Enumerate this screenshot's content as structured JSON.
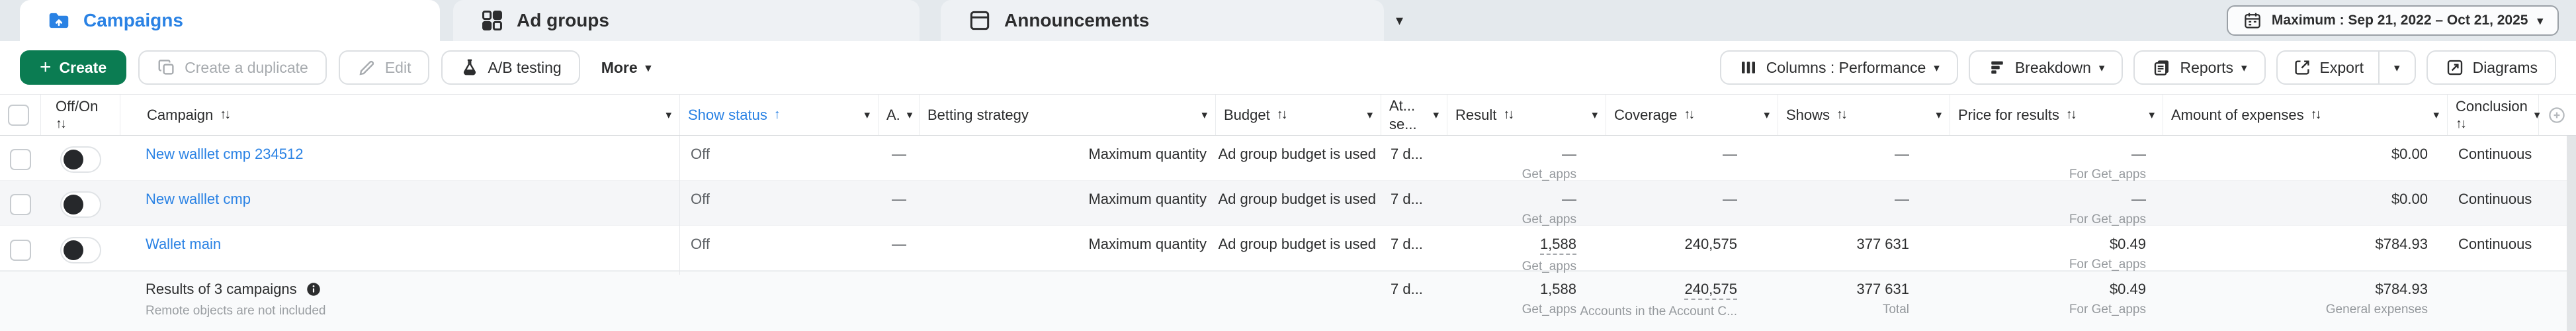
{
  "colors": {
    "accent_blue": "#2a82e4",
    "accent_green": "#0b7c52",
    "text_dark": "#2c2d2e",
    "text_gray": "#95999d"
  },
  "tabs": {
    "campaigns": "Campaigns",
    "ad_groups": "Ad groups",
    "announcements": "Announcements"
  },
  "date_range": {
    "label": "Maximum : Sep 21, 2022 – Oct 21, 2025"
  },
  "toolbar": {
    "create": "Create",
    "duplicate": "Create a duplicate",
    "edit": "Edit",
    "ab_testing": "A/B testing",
    "more": "More",
    "columns": "Columns : Performance",
    "breakdown": "Breakdown",
    "reports": "Reports",
    "export": "Export",
    "diagrams": "Diagrams"
  },
  "icons": {
    "caret_down": "▾",
    "sort_both": "↑↓",
    "sort_up": "↑",
    "plus": "+"
  },
  "table": {
    "headers": {
      "off_on": "Off/On",
      "campaign": "Campaign",
      "show_status": "Show status",
      "account": "A.",
      "betting_strategy": "Betting strategy",
      "budget": "Budget",
      "at_line1": "At...",
      "at_line2": "se...",
      "result": "Result",
      "coverage": "Coverage",
      "shows": "Shows",
      "price_for_results": "Price for results",
      "amount_of_expenses": "Amount of expenses",
      "conclusion": "Conclusion"
    },
    "rows": [
      {
        "campaign": "New walllet cmp 234512",
        "status": "Off",
        "account": "—",
        "betting_strategy": "Maximum quantity",
        "budget": "Ad group budget is used",
        "attribution": "7 d...",
        "result": "—",
        "result_sub": "Get_apps",
        "coverage": "—",
        "shows": "—",
        "price": "—",
        "price_sub": "For Get_apps",
        "expenses": "$0.00",
        "conclusion": "Continuous"
      },
      {
        "campaign": "New walllet cmp",
        "status": "Off",
        "account": "—",
        "betting_strategy": "Maximum quantity",
        "budget": "Ad group budget is used",
        "attribution": "7 d...",
        "result": "—",
        "result_sub": "Get_apps",
        "coverage": "—",
        "shows": "—",
        "price": "—",
        "price_sub": "For Get_apps",
        "expenses": "$0.00",
        "conclusion": "Continuous"
      },
      {
        "campaign": "Wallet main",
        "status": "Off",
        "account": "—",
        "betting_strategy": "Maximum quantity",
        "budget": "Ad group budget is used",
        "attribution": "7 d...",
        "result": "1,588",
        "result_sub": "Get_apps",
        "coverage": "240,575",
        "shows": "377 631",
        "price": "$0.49",
        "price_sub": "For Get_apps",
        "expenses": "$784.93",
        "conclusion": "Continuous"
      }
    ],
    "footer": {
      "title": "Results of 3 campaigns",
      "note": "Remote objects are not included",
      "attribution": "7 d...",
      "result": "1,588",
      "result_sub": "Get_apps",
      "coverage": "240,575",
      "coverage_sub": "Accounts in the Account C...",
      "shows": "377 631",
      "shows_sub": "Total",
      "price": "$0.49",
      "price_sub": "For Get_apps",
      "expenses": "$784.93",
      "expenses_sub": "General expenses"
    }
  }
}
